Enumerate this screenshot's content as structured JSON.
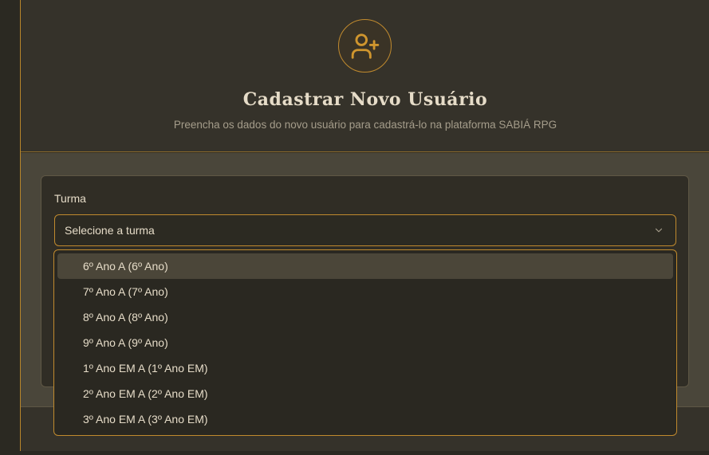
{
  "header": {
    "title": "Cadastrar Novo Usuário",
    "subtitle": "Preencha os dados do novo usuário para cadastrá-lo na plataforma SABIÁ RPG",
    "icon": "user-plus-icon"
  },
  "form": {
    "turma_label": "Turma",
    "turma_select_value": "Selecione a turma"
  },
  "dropdown": {
    "options": [
      "6º Ano A (6º Ano)",
      "7º Ano A (7º Ano)",
      "8º Ano A (8º Ano)",
      "9º Ano A (9º Ano)",
      "1º Ano EM A (1º Ano EM)",
      "2º Ano EM A (2º Ano EM)",
      "3º Ano EM A (3º Ano EM)"
    ],
    "highlighted_index": 0
  },
  "colors": {
    "accent": "#c08a2e",
    "background": "#322f26",
    "text": "#e6dcc8"
  }
}
